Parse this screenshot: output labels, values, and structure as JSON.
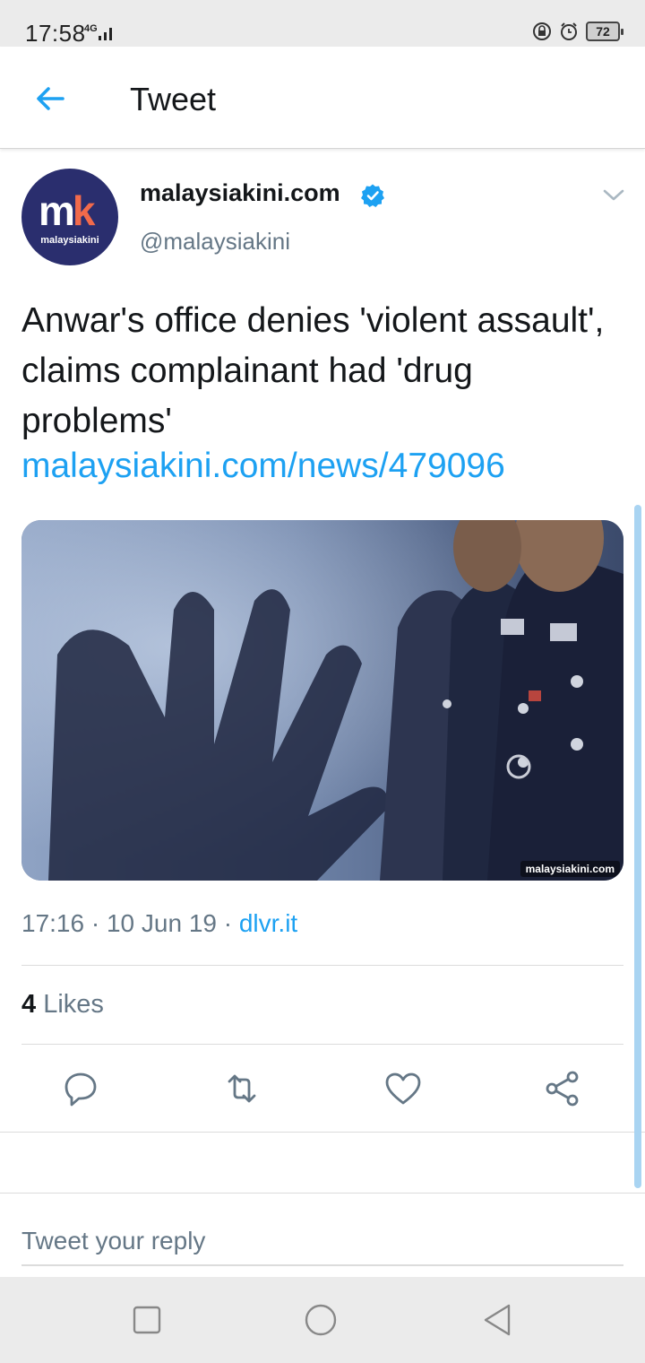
{
  "status_bar": {
    "time": "17:58",
    "network": "4G",
    "battery": "72"
  },
  "header": {
    "title": "Tweet"
  },
  "tweet": {
    "avatar_logo_text": "mk",
    "avatar_sub_text": "malaysiakini",
    "display_name": "malaysiakini.com",
    "handle": "@malaysiakini",
    "text": "Anwar's office denies 'violent assault', claims complainant had 'drug problems'",
    "link": "malaysiakini.com/news/479096",
    "media_watermark": "malaysiakini.com",
    "time": "17:16",
    "date": "10 Jun 19",
    "source": "dlvr.it",
    "likes_count": "4",
    "likes_label": "Likes"
  },
  "reply": {
    "placeholder": "Tweet your reply"
  },
  "colors": {
    "accent": "#1da1f2",
    "text_primary": "#14171a",
    "text_secondary": "#657786",
    "avatar_bg": "#2a2e6e",
    "avatar_accent": "#f26a4b"
  },
  "icons": {
    "back": "arrow-left-icon",
    "verified": "verified-badge-icon",
    "caret": "chevron-down-icon",
    "reply": "reply-icon",
    "retweet": "retweet-icon",
    "like": "heart-icon",
    "share": "share-icon"
  }
}
